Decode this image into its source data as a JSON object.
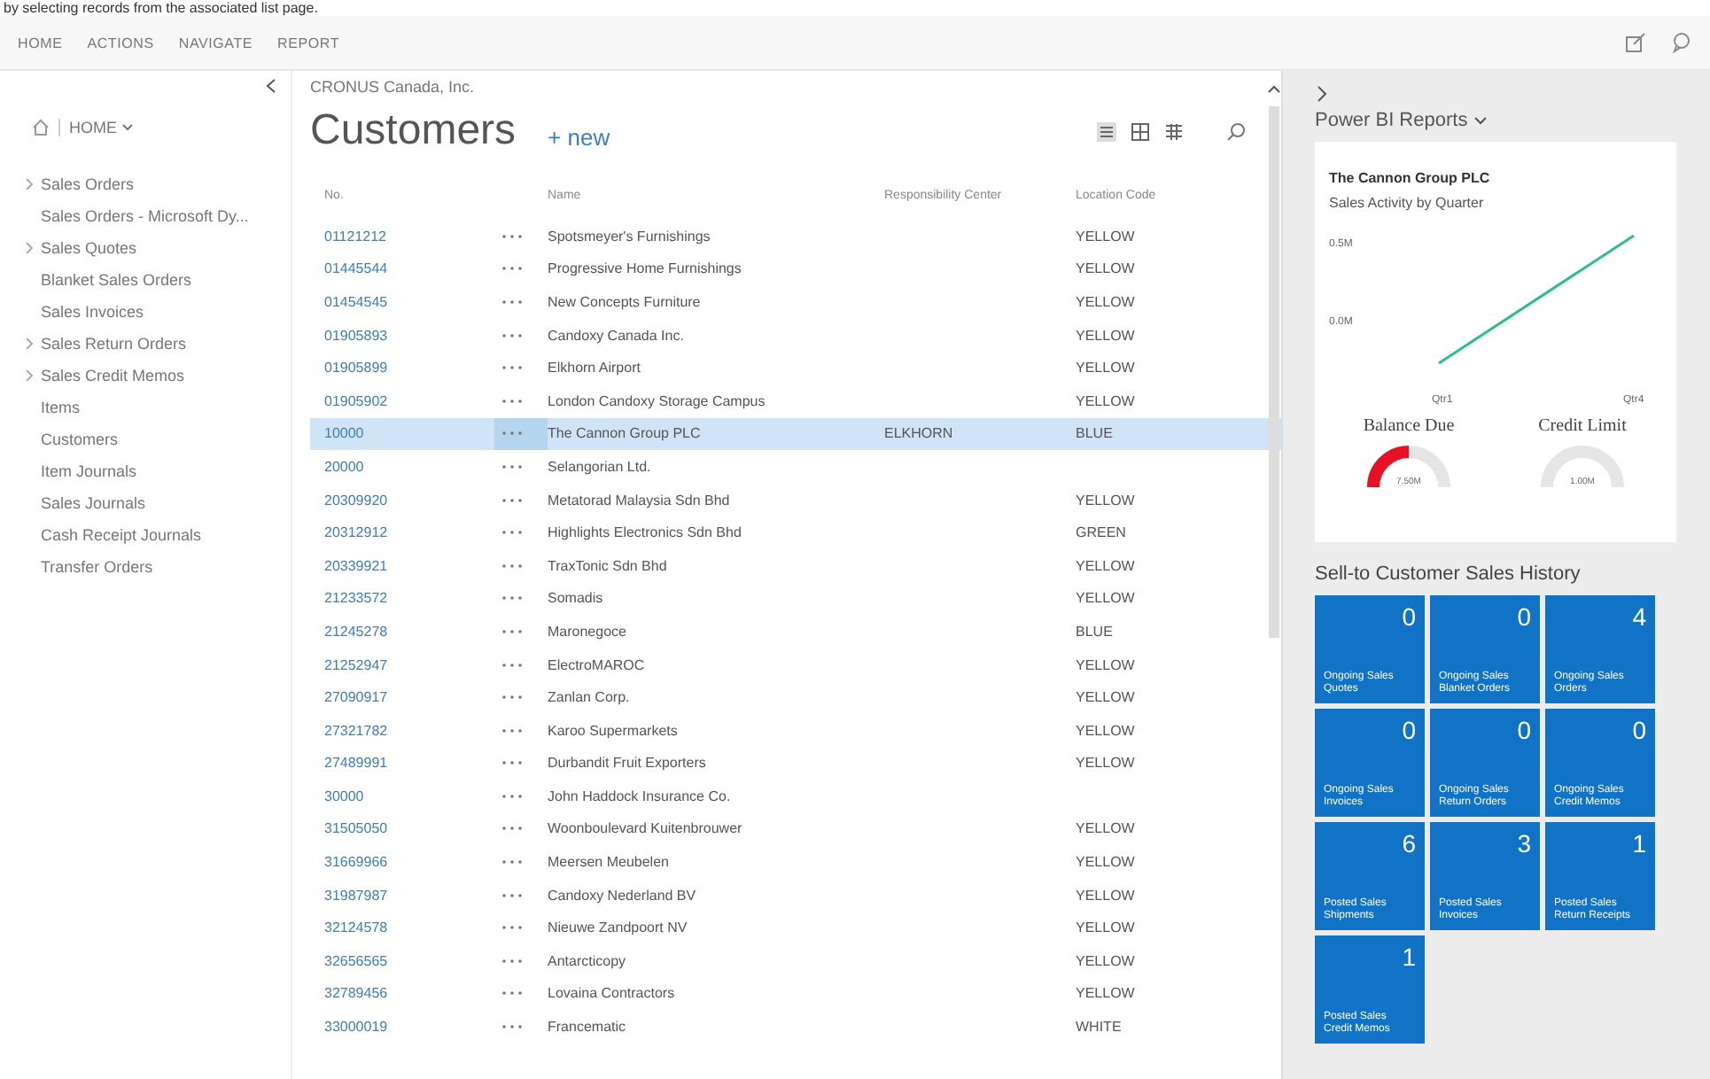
{
  "caption": "by selecting records from the associated list page.",
  "menu": [
    {
      "label": "HOME"
    },
    {
      "label": "ACTIONS"
    },
    {
      "label": "NAVIGATE"
    },
    {
      "label": "REPORT"
    }
  ],
  "nav": {
    "home_label": "HOME",
    "items": [
      {
        "label": "Sales Orders",
        "has_children": true
      },
      {
        "label": "Sales Orders - Microsoft Dy...",
        "has_children": false
      },
      {
        "label": "Sales Quotes",
        "has_children": true
      },
      {
        "label": "Blanket Sales Orders",
        "has_children": false
      },
      {
        "label": "Sales Invoices",
        "has_children": false
      },
      {
        "label": "Sales Return Orders",
        "has_children": true
      },
      {
        "label": "Sales Credit Memos",
        "has_children": true
      },
      {
        "label": "Items",
        "has_children": false
      },
      {
        "label": "Customers",
        "has_children": false
      },
      {
        "label": "Item Journals",
        "has_children": false
      },
      {
        "label": "Sales Journals",
        "has_children": false
      },
      {
        "label": "Cash Receipt Journals",
        "has_children": false
      },
      {
        "label": "Transfer Orders",
        "has_children": false
      }
    ]
  },
  "company": "CRONUS Canada, Inc.",
  "page_title": "Customers",
  "new_label": "+ new",
  "table": {
    "columns": [
      "No.",
      "Name",
      "Responsibility Center",
      "Location Code"
    ],
    "rows": [
      {
        "no": "01121212",
        "name": "Spotsmeyer's Furnishings",
        "center": "",
        "location": "YELLOW",
        "selected": false
      },
      {
        "no": "01445544",
        "name": "Progressive Home Furnishings",
        "center": "",
        "location": "YELLOW",
        "selected": false
      },
      {
        "no": "01454545",
        "name": "New Concepts Furniture",
        "center": "",
        "location": "YELLOW",
        "selected": false
      },
      {
        "no": "01905893",
        "name": "Candoxy Canada Inc.",
        "center": "",
        "location": "YELLOW",
        "selected": false
      },
      {
        "no": "01905899",
        "name": "Elkhorn Airport",
        "center": "",
        "location": "YELLOW",
        "selected": false
      },
      {
        "no": "01905902",
        "name": "London Candoxy Storage Campus",
        "center": "",
        "location": "YELLOW",
        "selected": false
      },
      {
        "no": "10000",
        "name": "The Cannon Group PLC",
        "center": "ELKHORN",
        "location": "BLUE",
        "selected": true
      },
      {
        "no": "20000",
        "name": "Selangorian Ltd.",
        "center": "",
        "location": "",
        "selected": false
      },
      {
        "no": "20309920",
        "name": "Metatorad Malaysia Sdn Bhd",
        "center": "",
        "location": "YELLOW",
        "selected": false
      },
      {
        "no": "20312912",
        "name": "Highlights Electronics Sdn Bhd",
        "center": "",
        "location": "GREEN",
        "selected": false
      },
      {
        "no": "20339921",
        "name": "TraxTonic Sdn Bhd",
        "center": "",
        "location": "YELLOW",
        "selected": false
      },
      {
        "no": "21233572",
        "name": "Somadis",
        "center": "",
        "location": "YELLOW",
        "selected": false
      },
      {
        "no": "21245278",
        "name": "Maronegoce",
        "center": "",
        "location": "BLUE",
        "selected": false
      },
      {
        "no": "21252947",
        "name": "ElectroMAROC",
        "center": "",
        "location": "YELLOW",
        "selected": false
      },
      {
        "no": "27090917",
        "name": "Zanlan Corp.",
        "center": "",
        "location": "YELLOW",
        "selected": false
      },
      {
        "no": "27321782",
        "name": "Karoo Supermarkets",
        "center": "",
        "location": "YELLOW",
        "selected": false
      },
      {
        "no": "27489991",
        "name": "Durbandit Fruit Exporters",
        "center": "",
        "location": "YELLOW",
        "selected": false
      },
      {
        "no": "30000",
        "name": "John Haddock Insurance Co.",
        "center": "",
        "location": "",
        "selected": false
      },
      {
        "no": "31505050",
        "name": "Woonboulevard Kuitenbrouwer",
        "center": "",
        "location": "YELLOW",
        "selected": false
      },
      {
        "no": "31669966",
        "name": "Meersen Meubelen",
        "center": "",
        "location": "YELLOW",
        "selected": false
      },
      {
        "no": "31987987",
        "name": "Candoxy Nederland BV",
        "center": "",
        "location": "YELLOW",
        "selected": false
      },
      {
        "no": "32124578",
        "name": "Nieuwe Zandpoort NV",
        "center": "",
        "location": "YELLOW",
        "selected": false
      },
      {
        "no": "32656565",
        "name": "Antarcticopy",
        "center": "",
        "location": "YELLOW",
        "selected": false
      },
      {
        "no": "32789456",
        "name": "Lovaina Contractors",
        "center": "",
        "location": "YELLOW",
        "selected": false
      },
      {
        "no": "33000019",
        "name": "Francematic",
        "center": "",
        "location": "WHITE",
        "selected": false
      }
    ]
  },
  "factbox": {
    "title": "Power BI Reports",
    "report": {
      "customer": "The Cannon Group PLC",
      "subtitle": "Sales Activity by Quarter",
      "y_labels": [
        "0.5M",
        "0.0M"
      ],
      "x_labels": [
        "Qtr1",
        "Qtr4"
      ],
      "gauges": [
        {
          "title": "Balance Due",
          "reading": "7.50M",
          "level": 0.5,
          "color": "#e81123"
        },
        {
          "title": "Credit Limit",
          "reading": "1.00M"
        }
      ]
    },
    "history_title": "Sell-to Customer Sales History",
    "tiles": [
      {
        "count": "0",
        "label": "Ongoing Sales Quotes"
      },
      {
        "count": "0",
        "label": "Ongoing Sales Blanket Orders"
      },
      {
        "count": "4",
        "label": "Ongoing Sales Orders"
      },
      {
        "count": "0",
        "label": "Ongoing Sales Invoices"
      },
      {
        "count": "0",
        "label": "Ongoing Sales Return Orders"
      },
      {
        "count": "0",
        "label": "Ongoing Sales Credit Memos"
      },
      {
        "count": "6",
        "label": "Posted Sales Shipments"
      },
      {
        "count": "3",
        "label": "Posted Sales Invoices"
      },
      {
        "count": "1",
        "label": "Posted Sales Return Receipts"
      },
      {
        "count": "1",
        "label": "Posted Sales Credit Memos"
      }
    ]
  }
}
